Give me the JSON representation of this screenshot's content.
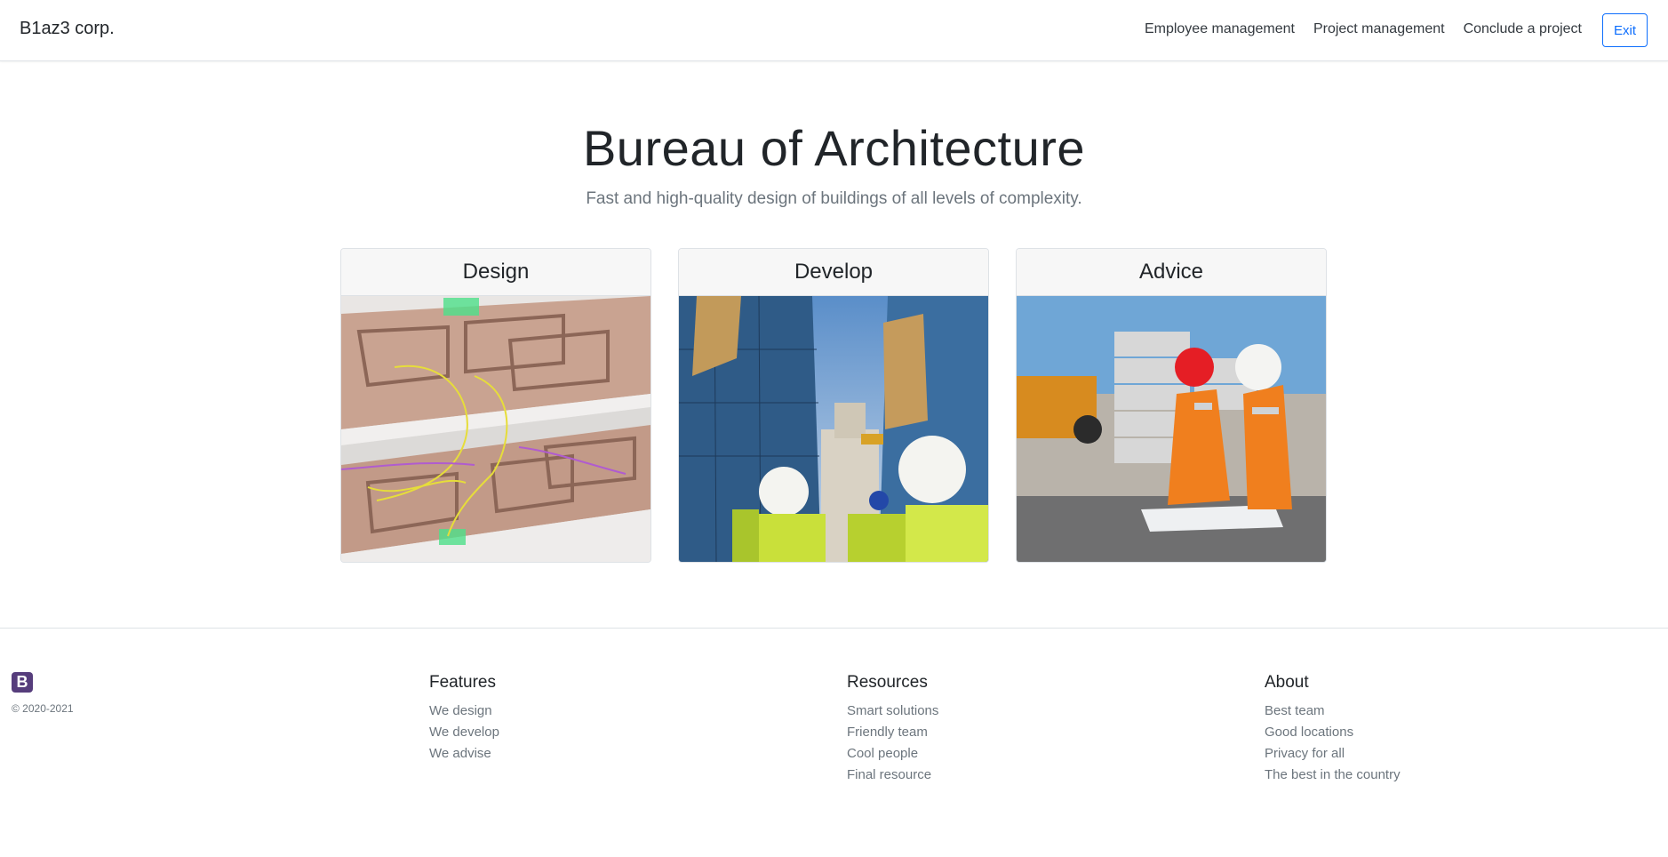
{
  "navbar": {
    "brand": "B1az3 corp.",
    "links": [
      "Employee management",
      "Project management",
      "Conclude a project"
    ],
    "exit_label": "Exit"
  },
  "hero": {
    "title": "Bureau of Architecture",
    "subtitle": "Fast and high-quality design of buildings of all levels of complexity."
  },
  "cards": [
    {
      "title": "Design",
      "image": "building-floor-plan-3d"
    },
    {
      "title": "Develop",
      "image": "construction-workers-skyscrapers"
    },
    {
      "title": "Advice",
      "image": "engineers-reviewing-blueprints"
    }
  ],
  "footer": {
    "logo": "B",
    "copyright": "© 2020-2021",
    "columns": [
      {
        "title": "Features",
        "links": [
          "We design",
          "We develop",
          "We advise"
        ]
      },
      {
        "title": "Resources",
        "links": [
          "Smart solutions",
          "Friendly team",
          "Cool people",
          "Final resource"
        ]
      },
      {
        "title": "About",
        "links": [
          "Best team",
          "Good locations",
          "Privacy for all",
          "The best in the country"
        ]
      }
    ]
  },
  "colors": {
    "accent": "#0d6efd",
    "logo": "#563d7c",
    "muted": "#6c757d"
  }
}
